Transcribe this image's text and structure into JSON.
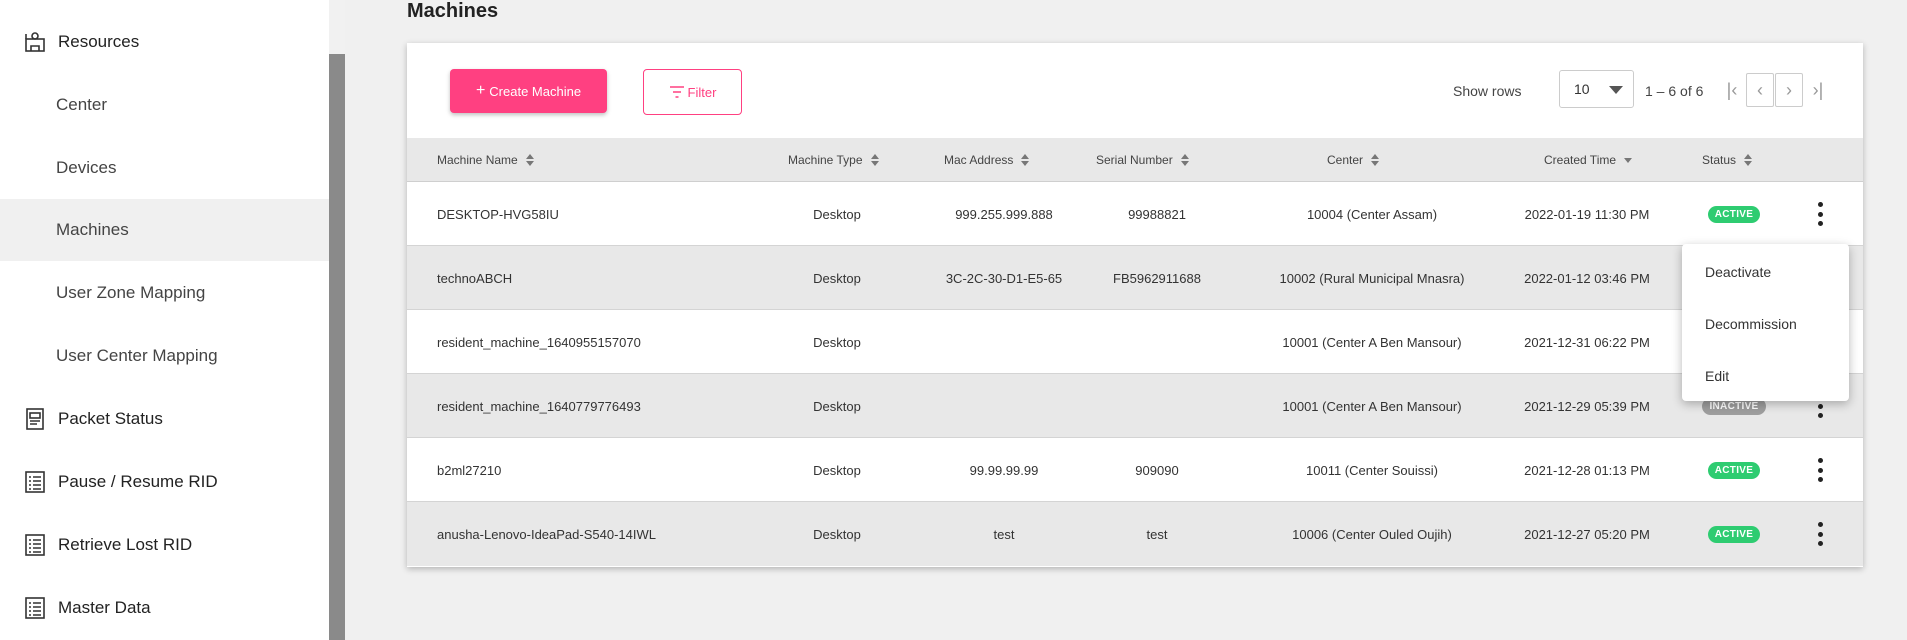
{
  "sidebar": {
    "items": [
      {
        "label": "Resources",
        "type": "section",
        "icon": "resources-icon"
      },
      {
        "label": "Center",
        "type": "sub"
      },
      {
        "label": "Devices",
        "type": "sub"
      },
      {
        "label": "Machines",
        "type": "sub",
        "active": true
      },
      {
        "label": "User Zone Mapping",
        "type": "sub"
      },
      {
        "label": "User Center Mapping",
        "type": "sub"
      },
      {
        "label": "Packet Status",
        "type": "section",
        "icon": "packet-icon"
      },
      {
        "label": "Pause / Resume RID",
        "type": "section",
        "icon": "list-icon"
      },
      {
        "label": "Retrieve Lost RID",
        "type": "section",
        "icon": "list-icon"
      },
      {
        "label": "Master Data",
        "type": "section",
        "icon": "list-icon"
      }
    ]
  },
  "page": {
    "title": "Machines"
  },
  "toolbar": {
    "create_label": "Create Machine",
    "filter_label": "Filter",
    "show_rows_label": "Show rows",
    "rows_value": "10",
    "range_label": "1 – 6 of 6"
  },
  "table": {
    "headers": [
      "Machine Name",
      "Machine Type",
      "Mac Address",
      "Serial Number",
      "Center",
      "Created Time",
      "Status"
    ],
    "rows": [
      {
        "name": "DESKTOP-HVG58IU",
        "type": "Desktop",
        "mac": "999.255.999.888",
        "serial": "99988821",
        "center": "10004 (Center Assam)",
        "created": "2022-01-19 11:30 PM",
        "status": "ACTIVE"
      },
      {
        "name": "technoABCH",
        "type": "Desktop",
        "mac": "3C-2C-30-D1-E5-65",
        "serial": "FB5962911688",
        "center": "10002 (Rural Municipal Mnasra)",
        "created": "2022-01-12 03:46 PM",
        "status": ""
      },
      {
        "name": "resident_machine_1640955157070",
        "type": "Desktop",
        "mac": "",
        "serial": "",
        "center": "10001 (Center A Ben Mansour)",
        "created": "2021-12-31 06:22 PM",
        "status": ""
      },
      {
        "name": "resident_machine_1640779776493",
        "type": "Desktop",
        "mac": "",
        "serial": "",
        "center": "10001 (Center A Ben Mansour)",
        "created": "2021-12-29 05:39 PM",
        "status": "INACTIVE"
      },
      {
        "name": "b2ml27210",
        "type": "Desktop",
        "mac": "99.99.99.99",
        "serial": "909090",
        "center": "10011 (Center Souissi)",
        "created": "2021-12-28 01:13 PM",
        "status": "ACTIVE"
      },
      {
        "name": "anusha-Lenovo-IdeaPad-S540-14IWL",
        "type": "Desktop",
        "mac": "test",
        "serial": "test",
        "center": "10006 (Center Ouled Oujih)",
        "created": "2021-12-27 05:20 PM",
        "status": "ACTIVE"
      }
    ]
  },
  "menu": {
    "items": [
      "Deactivate",
      "Decommission",
      "Edit"
    ]
  },
  "colors": {
    "accent": "#ff4081",
    "active": "#2ecc71",
    "inactive": "#9e9e9e"
  }
}
